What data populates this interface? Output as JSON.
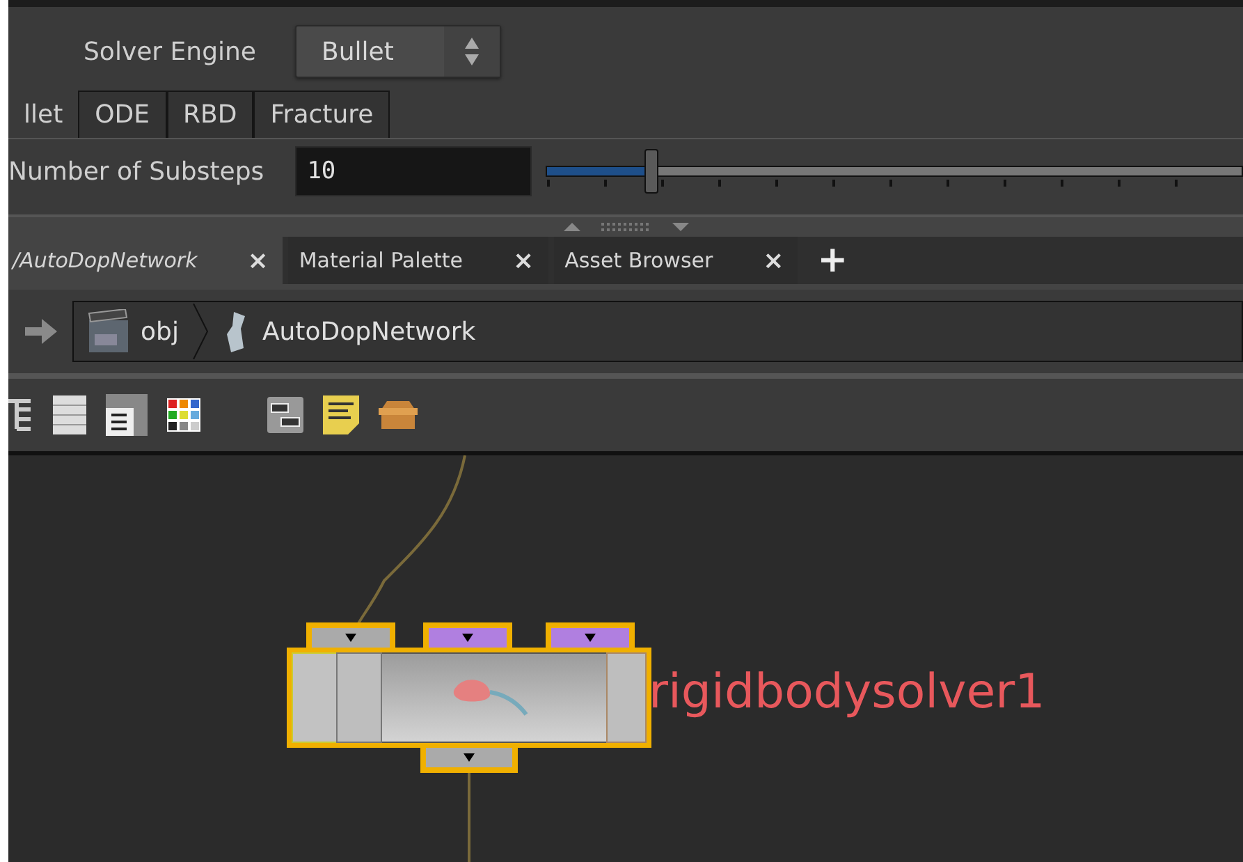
{
  "parameters": {
    "solver_engine": {
      "label": "Solver Engine",
      "value": "Bullet"
    },
    "tabs": [
      {
        "label": "llet",
        "selected": true
      },
      {
        "label": "ODE",
        "selected": false
      },
      {
        "label": "RBD",
        "selected": false
      },
      {
        "label": "Fracture",
        "selected": false
      }
    ],
    "substeps": {
      "label": "Number of Substeps",
      "value": "10",
      "level": 0.15
    }
  },
  "pane_tabs": [
    {
      "label": "/AutoDopNetwork",
      "selected": true,
      "close": "×"
    },
    {
      "label": "Material Palette",
      "selected": false,
      "close": "×"
    },
    {
      "label": "Asset Browser",
      "selected": false,
      "close": "×"
    }
  ],
  "add_tab": "+",
  "path": [
    {
      "label": "obj",
      "kind": "scene"
    },
    {
      "label": "AutoDopNetwork",
      "kind": "dop"
    }
  ],
  "node": {
    "name": "rigidbodysolver1",
    "selected": true
  }
}
